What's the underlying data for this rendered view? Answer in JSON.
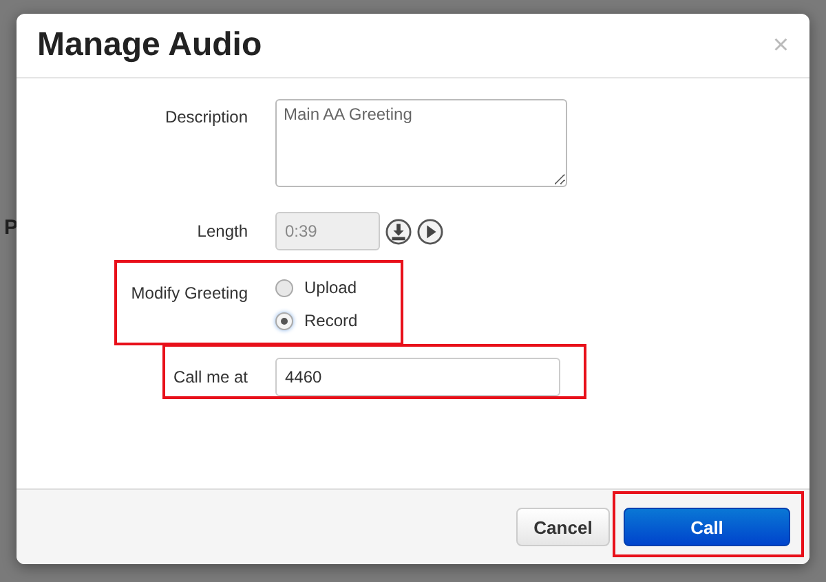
{
  "background_page": {
    "fragment": "P"
  },
  "dialog": {
    "title": "Manage Audio",
    "close": "×"
  },
  "fields": [
    {
      "kind": "textarea",
      "label": "Description",
      "value": "Main AA Greeting"
    },
    {
      "kind": "length",
      "label": "Length",
      "value": "0:39",
      "disabled": true
    },
    {
      "kind": "radio",
      "label": "Modify Greeting",
      "highlighted": true,
      "options": [
        {
          "label": "Upload",
          "selected": false
        },
        {
          "label": "Record",
          "selected": true
        }
      ]
    },
    {
      "kind": "text",
      "label": "Call me at",
      "value": "4460",
      "highlighted": true
    }
  ],
  "buttons": [
    {
      "label": "Cancel",
      "primary": false,
      "highlighted": false
    },
    {
      "label": "Call",
      "primary": true,
      "highlighted": true
    }
  ]
}
